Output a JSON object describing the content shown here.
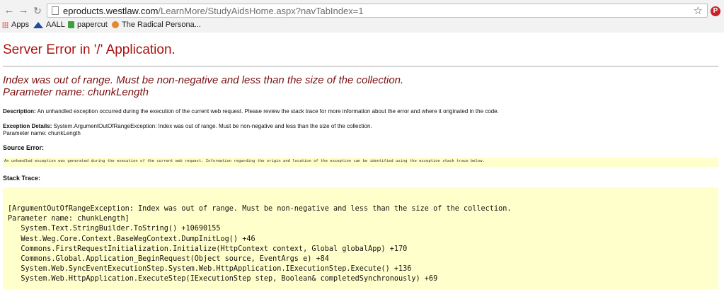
{
  "browser": {
    "url_host": "eproducts.westlaw.com",
    "url_path": "/LearnMore/StudyAidsHome.aspx?navTabIndex=1",
    "bookmarks": [
      "Apps",
      "AALL",
      "papercut",
      "The Radical Persona..."
    ]
  },
  "page": {
    "title": "Server Error in '/' Application.",
    "error_line1": "Index was out of range. Must be non-negative and less than the size of the collection.",
    "error_line2": "Parameter name: chunkLength",
    "description_label": "Description:",
    "description_text": "An unhandled exception occurred during the execution of the current web request. Please review the stack trace for more information about the error and where it originated in the code.",
    "exception_label": "Exception Details:",
    "exception_text": "System.ArgumentOutOfRangeException: Index was out of range. Must be non-negative and less than the size of the collection.",
    "exception_param": "Parameter name: chunkLength",
    "source_error_label": "Source Error:",
    "source_error_text": "An unhandled exception was generated during the execution of the current web request. Information regarding the origin and location of the exception can be identified using the exception stack trace below.",
    "stack_trace_label": "Stack Trace:",
    "stack_trace": [
      "[ArgumentOutOfRangeException: Index was out of range. Must be non-negative and less than the size of the collection.",
      "Parameter name: chunkLength]",
      "   System.Text.StringBuilder.ToString() +10690155",
      "   West.Weg.Core.Context.BaseWegContext.DumpInitLog() +46",
      "   Commons.FirstRequestInitialization.Initialize(HttpContext context, Global globalApp) +170",
      "   Commons.Global.Application_BeginRequest(Object source, EventArgs e) +84",
      "   System.Web.SyncEventExecutionStep.System.Web.HttpApplication.IExecutionStep.Execute() +136",
      "   System.Web.HttpApplication.ExecuteStep(IExecutionStep step, Boolean& completedSynchronously) +69"
    ]
  }
}
